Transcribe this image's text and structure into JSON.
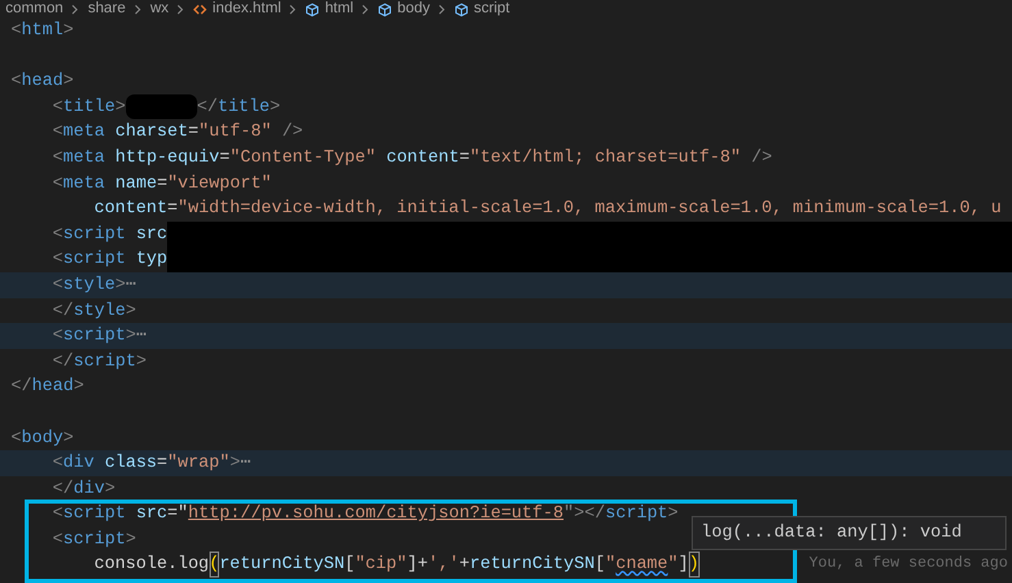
{
  "breadcrumbs": [
    {
      "label": "common",
      "kind": "folder"
    },
    {
      "label": "share",
      "kind": "folder"
    },
    {
      "label": "wx",
      "kind": "folder"
    },
    {
      "label": "index.html",
      "kind": "file"
    },
    {
      "label": "html",
      "kind": "element"
    },
    {
      "label": "body",
      "kind": "element"
    },
    {
      "label": "script",
      "kind": "element"
    }
  ],
  "lines": [
    {
      "kind": "code",
      "folded": false,
      "tokens": [
        {
          "kind": "punct",
          "text": "<"
        },
        {
          "kind": "tag",
          "text": "html"
        },
        {
          "kind": "punct",
          "text": ">"
        }
      ]
    },
    {
      "kind": "blank"
    },
    {
      "kind": "code",
      "folded": false,
      "tokens": [
        {
          "kind": "punct",
          "text": "<"
        },
        {
          "kind": "tag",
          "text": "head"
        },
        {
          "kind": "punct",
          "text": ">"
        }
      ],
      "children": [
        {
          "kind": "code",
          "folded": false,
          "tokens": [
            {
              "kind": "punct",
              "text": "<"
            },
            {
              "kind": "tag",
              "text": "title"
            },
            {
              "kind": "punct",
              "text": ">"
            },
            {
              "kind": "redacted"
            },
            {
              "kind": "punct",
              "text": "</"
            },
            {
              "kind": "tag",
              "text": "title"
            },
            {
              "kind": "punct",
              "text": ">"
            }
          ]
        },
        {
          "kind": "code",
          "folded": false,
          "tokens": [
            {
              "kind": "punct",
              "text": "<"
            },
            {
              "kind": "tag",
              "text": "meta"
            },
            {
              "kind": "attr",
              "text": " charset"
            },
            {
              "kind": "plain",
              "text": "="
            },
            {
              "kind": "string",
              "text": "\"utf-8\""
            },
            {
              "kind": "punct",
              "text": " />"
            }
          ]
        },
        {
          "kind": "code",
          "folded": false,
          "tokens": [
            {
              "kind": "punct",
              "text": "<"
            },
            {
              "kind": "tag",
              "text": "meta"
            },
            {
              "kind": "attr",
              "text": " http-equiv"
            },
            {
              "kind": "plain",
              "text": "="
            },
            {
              "kind": "string",
              "text": "\"Content-Type\""
            },
            {
              "kind": "attr",
              "text": " content"
            },
            {
              "kind": "plain",
              "text": "="
            },
            {
              "kind": "string",
              "text": "\"text/html; charset=utf-8\""
            },
            {
              "kind": "punct",
              "text": " />"
            }
          ]
        },
        {
          "kind": "code",
          "folded": false,
          "tokens": [
            {
              "kind": "punct",
              "text": "<"
            },
            {
              "kind": "tag",
              "text": "meta"
            },
            {
              "kind": "attr",
              "text": " name"
            },
            {
              "kind": "plain",
              "text": "="
            },
            {
              "kind": "string",
              "text": "\"viewport\""
            }
          ],
          "children": [
            {
              "kind": "code",
              "folded": false,
              "tokens": [
                {
                  "kind": "attr",
                  "text": "content"
                },
                {
                  "kind": "plain",
                  "text": "="
                },
                {
                  "kind": "string",
                  "text": "\"width=device-width, initial-scale=1.0, maximum-scale=1.0, minimum-scale=1.0, u"
                }
              ]
            }
          ]
        },
        {
          "kind": "code",
          "folded": false,
          "tokens": [
            {
              "kind": "punct",
              "text": "<"
            },
            {
              "kind": "tag",
              "text": "script"
            },
            {
              "kind": "attr",
              "text": " src"
            },
            {
              "kind": "redacted_rest"
            }
          ]
        },
        {
          "kind": "code",
          "folded": false,
          "tokens": [
            {
              "kind": "punct",
              "text": "<"
            },
            {
              "kind": "tag",
              "text": "script"
            },
            {
              "kind": "attr",
              "text": " typ"
            },
            {
              "kind": "redacted_rest"
            }
          ]
        },
        {
          "kind": "code",
          "folded": true,
          "tokens": [
            {
              "kind": "punct",
              "text": "<"
            },
            {
              "kind": "tag",
              "text": "style"
            },
            {
              "kind": "punct",
              "text": ">"
            },
            {
              "kind": "fold",
              "text": "⋯"
            }
          ]
        },
        {
          "kind": "code",
          "folded": false,
          "tokens": [
            {
              "kind": "punct",
              "text": "</"
            },
            {
              "kind": "tag",
              "text": "style"
            },
            {
              "kind": "punct",
              "text": ">"
            }
          ]
        },
        {
          "kind": "code",
          "folded": true,
          "tokens": [
            {
              "kind": "punct",
              "text": "<"
            },
            {
              "kind": "tag",
              "text": "script"
            },
            {
              "kind": "punct",
              "text": ">"
            },
            {
              "kind": "fold",
              "text": "⋯"
            }
          ]
        },
        {
          "kind": "code",
          "folded": false,
          "tokens": [
            {
              "kind": "punct",
              "text": "</"
            },
            {
              "kind": "tag",
              "text": "script"
            },
            {
              "kind": "punct",
              "text": ">"
            }
          ]
        }
      ]
    },
    {
      "kind": "code",
      "folded": false,
      "tokens": [
        {
          "kind": "punct",
          "text": "</"
        },
        {
          "kind": "tag",
          "text": "head"
        },
        {
          "kind": "punct",
          "text": ">"
        }
      ]
    },
    {
      "kind": "blank"
    },
    {
      "kind": "code",
      "folded": false,
      "tokens": [
        {
          "kind": "punct",
          "text": "<"
        },
        {
          "kind": "tag",
          "text": "body"
        },
        {
          "kind": "punct",
          "text": ">"
        }
      ],
      "children": [
        {
          "kind": "code",
          "folded": true,
          "tokens": [
            {
              "kind": "punct",
              "text": "<"
            },
            {
              "kind": "tag",
              "text": "div"
            },
            {
              "kind": "attr",
              "text": " class"
            },
            {
              "kind": "plain",
              "text": "="
            },
            {
              "kind": "string",
              "text": "\"wrap\""
            },
            {
              "kind": "punct",
              "text": ">"
            },
            {
              "kind": "fold",
              "text": "⋯"
            }
          ]
        },
        {
          "kind": "code",
          "folded": false,
          "tokens": [
            {
              "kind": "punct",
              "text": "</"
            },
            {
              "kind": "tag",
              "text": "div"
            },
            {
              "kind": "punct",
              "text": ">"
            }
          ]
        },
        {
          "kind": "code",
          "folded": false,
          "tokens": [
            {
              "kind": "punct",
              "text": "<"
            },
            {
              "kind": "tag",
              "text": "script"
            },
            {
              "kind": "attr",
              "text": " src"
            },
            {
              "kind": "plain",
              "text": "=\""
            },
            {
              "kind": "link",
              "text": "http://pv.sohu.com/cityjson?ie=utf-8"
            },
            {
              "kind": "punct",
              "text": "\"></"
            },
            {
              "kind": "tag",
              "text": "script"
            },
            {
              "kind": "punct",
              "text": ">"
            }
          ]
        },
        {
          "kind": "code",
          "folded": false,
          "tokens": [
            {
              "kind": "punct",
              "text": "<"
            },
            {
              "kind": "tag",
              "text": "script"
            },
            {
              "kind": "punct",
              "text": ">"
            }
          ],
          "children": [
            {
              "kind": "code",
              "folded": false,
              "tokens": [
                {
                  "kind": "plain",
                  "text": "console.log"
                },
                {
                  "kind": "bracket",
                  "text": "("
                },
                {
                  "kind": "var",
                  "text": "returnCitySN"
                },
                {
                  "kind": "plain",
                  "text": "["
                },
                {
                  "kind": "string",
                  "text": "\"cip\""
                },
                {
                  "kind": "plain",
                  "text": "]+"
                },
                {
                  "kind": "string",
                  "text": "','"
                },
                {
                  "kind": "plain",
                  "text": "+"
                },
                {
                  "kind": "var",
                  "text": "returnCitySN"
                },
                {
                  "kind": "plain",
                  "text": "["
                },
                {
                  "kind": "string",
                  "text": "\""
                },
                {
                  "kind": "warning",
                  "text": "cname"
                },
                {
                  "kind": "string",
                  "text": "\""
                },
                {
                  "kind": "plain",
                  "text": "]"
                },
                {
                  "kind": "bracket",
                  "text": ")"
                }
              ],
              "blame": "You, a few seconds ago"
            }
          ]
        }
      ]
    }
  ],
  "tooltip": "log(...data: any[]): void"
}
